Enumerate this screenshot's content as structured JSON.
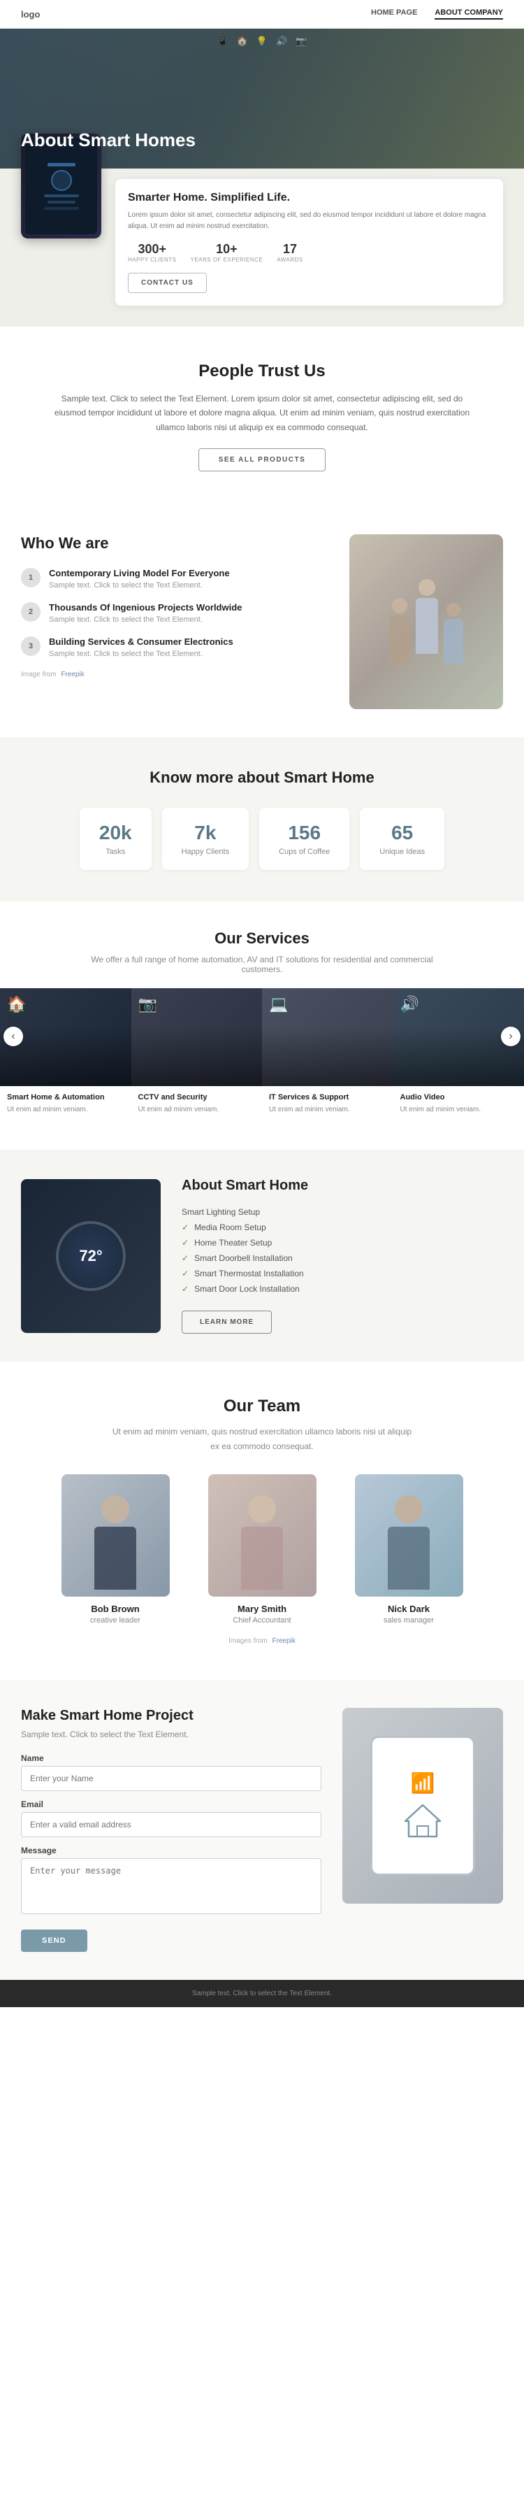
{
  "nav": {
    "logo": "logo",
    "links": [
      {
        "label": "HOME PAGE",
        "active": false
      },
      {
        "label": "ABOUT COMPANY",
        "active": true
      }
    ]
  },
  "hero": {
    "title": "About Smart Homes",
    "icons": [
      "📱",
      "🏠",
      "💡",
      "🔊",
      "📷"
    ]
  },
  "hero_card": {
    "tagline": "Smarter Home. Simplified Life.",
    "description": "Lorem ipsum dolor sit amet, consectetur adipiscing elit, sed do eiusmod tempor incididunt ut labore et dolore magna aliqua. Ut enim ad minim nostrud exercitation.",
    "stats": [
      {
        "num": "300+",
        "label": "HAPPY CLIENTS"
      },
      {
        "num": "10+",
        "label": "YEARS OF EXPERIENCE"
      },
      {
        "num": "17",
        "label": "AWARDS"
      }
    ],
    "contact_btn": "CONTACT US"
  },
  "trust_section": {
    "title": "People Trust Us",
    "text": "Sample text. Click to select the Text Element. Lorem ipsum dolor sit amet, consectetur adipiscing elit, sed do eiusmod tempor incididunt ut labore et dolore magna aliqua. Ut enim ad minim veniam, quis nostrud exercitation ullamco laboris nisi ut aliquip ex ea commodo consequat.",
    "btn": "SEE ALL PRODUCTS"
  },
  "who_section": {
    "title": "Who We are",
    "items": [
      {
        "num": "1",
        "title": "Contemporary Living Model For Everyone",
        "text": "Sample text. Click to select the Text Element."
      },
      {
        "num": "2",
        "title": "Thousands Of Ingenious Projects Worldwide",
        "text": "Sample text. Click to select the Text Element."
      },
      {
        "num": "3",
        "title": "Building Services & Consumer Electronics",
        "text": "Sample text. Click to select the Text Element."
      }
    ],
    "image_note": "Image from",
    "freepik_link": "Freepik"
  },
  "stats_banner": {
    "title": "Know more about Smart Home",
    "stats": [
      {
        "num": "20k",
        "label": "Tasks"
      },
      {
        "num": "7k",
        "label": "Happy Clients"
      },
      {
        "num": "156",
        "label": "Cups of Coffee"
      },
      {
        "num": "65",
        "label": "Unique Ideas"
      }
    ]
  },
  "services_section": {
    "title": "Our Services",
    "subtitle": "We offer a full range of home automation, AV and IT solutions for residential and commercial customers.",
    "items": [
      {
        "name": "Smart Home & Automation",
        "desc": "Ut enim ad minim veniam.",
        "icon": "🏠"
      },
      {
        "name": "CCTV and Security",
        "desc": "Ut enim ad minim veniam.",
        "icon": "📷"
      },
      {
        "name": "IT Services & Support",
        "desc": "Ut enim ad minim veniam.",
        "icon": "💻"
      },
      {
        "name": "Audio Video",
        "desc": "Ut enim ad minim veniam.",
        "icon": "🔊"
      }
    ],
    "prev_btn": "‹",
    "next_btn": "›"
  },
  "about_sh": {
    "title": "About Smart Home",
    "features": [
      "Smart Lighting Setup",
      "Media Room Setup",
      "Home Theater Setup",
      "Smart Doorbell Installation",
      "Smart Thermostat Installation",
      "Smart Door Lock Installation"
    ],
    "learn_btn": "LEARN MORE",
    "thermostat_value": "72°"
  },
  "team_section": {
    "title": "Our Team",
    "subtitle": "Ut enim ad minim veniam, quis nostrud exercitation ullamco laboris nisi ut aliquip ex ea commodo consequat.",
    "members": [
      {
        "name": "Bob Brown",
        "role": "creative leader"
      },
      {
        "name": "Mary Smith",
        "role": "Chief Accountant"
      },
      {
        "name": "Nick Dark",
        "role": "sales manager"
      }
    ],
    "image_note": "Images from",
    "freepik_link": "Freepik"
  },
  "contact_section": {
    "title": "Make Smart Home Project",
    "text": "Sample text. Click to select the Text Element.",
    "fields": [
      {
        "label": "Name",
        "placeholder": "Enter your Name",
        "type": "text",
        "id": "name"
      },
      {
        "label": "Email",
        "placeholder": "Enter a valid email address",
        "type": "email",
        "id": "email"
      },
      {
        "label": "Message",
        "placeholder": "Enter your message",
        "type": "textarea",
        "id": "message"
      }
    ],
    "send_btn": "SEND"
  },
  "footer": {
    "text": "Sample text. Click to select the Text Element."
  }
}
